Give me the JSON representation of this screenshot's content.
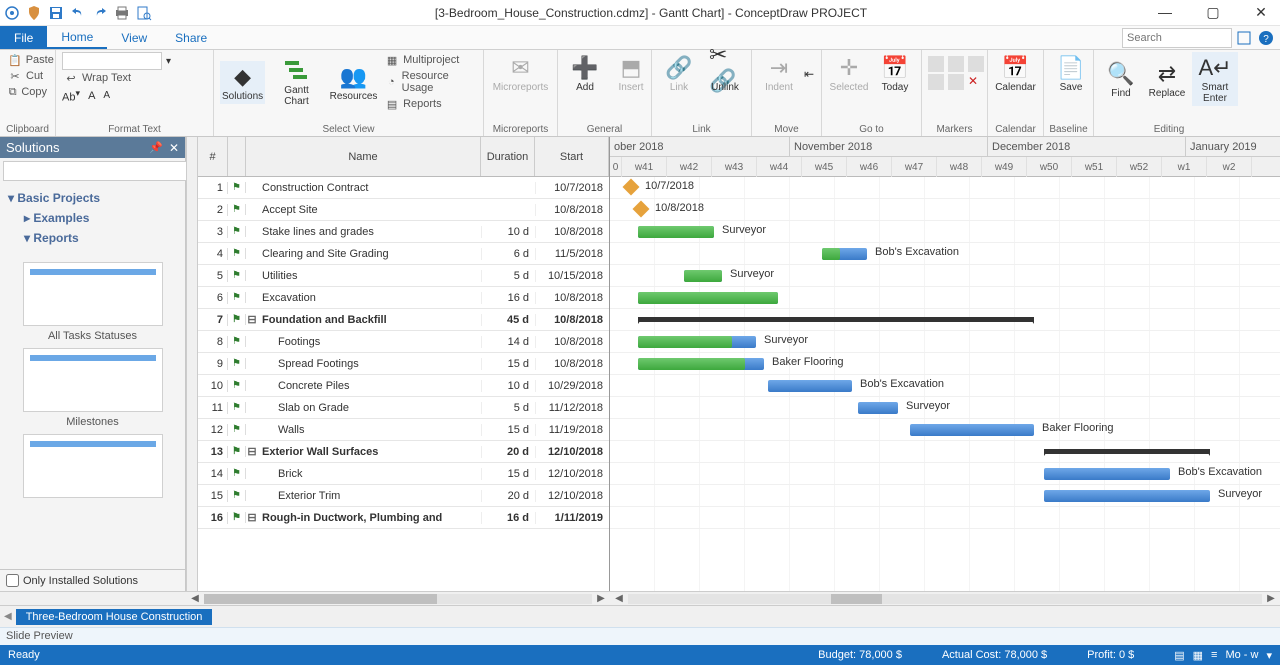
{
  "window": {
    "title": "[3-Bedroom_House_Construction.cdmz] - Gantt Chart] - ConceptDraw PROJECT",
    "controls": {
      "min": "—",
      "max": "▢",
      "close": "✕"
    }
  },
  "menubar": {
    "file": "File",
    "tabs": [
      "Home",
      "View",
      "Share"
    ],
    "active": "Home",
    "search_placeholder": "Search"
  },
  "ribbon": {
    "clipboard": {
      "paste": "Paste",
      "cut": "Cut",
      "copy": "Copy",
      "group": "Clipboard"
    },
    "formattext": {
      "wrap": "Wrap Text",
      "group": "Format Text"
    },
    "selectview": {
      "solutions": "Solutions",
      "gantt": "Gantt\nChart",
      "resources": "Resources",
      "multiproject": "Multiproject",
      "resource_usage": "Resource Usage",
      "reports": "Reports",
      "group": "Select View"
    },
    "micro": {
      "microreports": "Microreports",
      "group": "Microreports"
    },
    "general": {
      "add": "Add",
      "insert": "Insert",
      "group": "General"
    },
    "link": {
      "link": "Link",
      "unlink": "Unlink",
      "group": "Link"
    },
    "move": {
      "indent": "Indent",
      "group": "Move"
    },
    "goto": {
      "selected": "Selected",
      "today": "Today",
      "group": "Go to"
    },
    "markers": {
      "group": "Markers"
    },
    "calendar": {
      "calendar": "Calendar",
      "group": "Calendar"
    },
    "baseline": {
      "save": "Save",
      "group": "Baseline"
    },
    "editing": {
      "find": "Find",
      "replace": "Replace",
      "smart": "Smart\nEnter",
      "group": "Editing"
    }
  },
  "sidepanel": {
    "title": "Solutions",
    "tree": {
      "root": "Basic Projects",
      "children": [
        "Examples",
        "Reports"
      ]
    },
    "thumbs": [
      "All Tasks Statuses",
      "Milestones"
    ],
    "only_installed": "Only Installed Solutions"
  },
  "grid": {
    "headers": {
      "num": "#",
      "name": "Name",
      "duration": "Duration",
      "start": "Start"
    },
    "rows": [
      {
        "n": 1,
        "name": "Construction Contract",
        "dur": "",
        "start": "10/7/2018",
        "type": "ms",
        "indent": 0
      },
      {
        "n": 2,
        "name": "Accept Site",
        "dur": "",
        "start": "10/8/2018",
        "type": "ms",
        "indent": 0
      },
      {
        "n": 3,
        "name": "Stake lines and grades",
        "dur": "10 d",
        "start": "10/8/2018",
        "type": "task",
        "indent": 0,
        "res": "Surveyor",
        "complete": 1,
        "barStart": 28,
        "barW": 76
      },
      {
        "n": 4,
        "name": "Clearing and Site Grading",
        "dur": "6 d",
        "start": "11/5/2018",
        "type": "task",
        "indent": 0,
        "res": "Bob's Excavation",
        "complete": 0.4,
        "barStart": 212,
        "barW": 45
      },
      {
        "n": 5,
        "name": "Utilities",
        "dur": "5 d",
        "start": "10/15/2018",
        "type": "task",
        "indent": 0,
        "res": "Surveyor",
        "complete": 1,
        "barStart": 74,
        "barW": 38
      },
      {
        "n": 6,
        "name": "Excavation",
        "dur": "16 d",
        "start": "10/8/2018",
        "type": "task",
        "indent": 0,
        "res": "",
        "complete": 1,
        "barStart": 28,
        "barW": 140
      },
      {
        "n": 7,
        "name": "Foundation and Backfill",
        "dur": "45 d",
        "start": "10/8/2018",
        "type": "summary",
        "indent": 0,
        "barStart": 28,
        "barW": 396
      },
      {
        "n": 8,
        "name": "Footings",
        "dur": "14 d",
        "start": "10/8/2018",
        "type": "task",
        "indent": 1,
        "res": "Surveyor",
        "complete": 0.8,
        "barStart": 28,
        "barW": 118
      },
      {
        "n": 9,
        "name": "Spread Footings",
        "dur": "15 d",
        "start": "10/8/2018",
        "type": "task",
        "indent": 1,
        "res": "Baker Flooring",
        "complete": 0.85,
        "barStart": 28,
        "barW": 126
      },
      {
        "n": 10,
        "name": "Concrete Piles",
        "dur": "10 d",
        "start": "10/29/2018",
        "type": "task",
        "indent": 1,
        "res": "Bob's Excavation",
        "complete": 0,
        "barStart": 158,
        "barW": 84
      },
      {
        "n": 11,
        "name": "Slab on Grade",
        "dur": "5 d",
        "start": "11/12/2018",
        "type": "task",
        "indent": 1,
        "res": "Surveyor",
        "complete": 0,
        "barStart": 248,
        "barW": 40
      },
      {
        "n": 12,
        "name": "Walls",
        "dur": "15 d",
        "start": "11/19/2018",
        "type": "task",
        "indent": 1,
        "res": "Baker Flooring",
        "complete": 0,
        "barStart": 300,
        "barW": 124
      },
      {
        "n": 13,
        "name": "Exterior Wall Surfaces",
        "dur": "20 d",
        "start": "12/10/2018",
        "type": "summary",
        "indent": 0,
        "barStart": 434,
        "barW": 166
      },
      {
        "n": 14,
        "name": "Brick",
        "dur": "15 d",
        "start": "12/10/2018",
        "type": "task",
        "indent": 1,
        "res": "Bob's Excavation",
        "complete": 0,
        "barStart": 434,
        "barW": 126
      },
      {
        "n": 15,
        "name": "Exterior Trim",
        "dur": "20 d",
        "start": "12/10/2018",
        "type": "task",
        "indent": 1,
        "res": "Surveyor",
        "complete": 0,
        "barStart": 434,
        "barW": 166
      },
      {
        "n": 16,
        "name": "Rough-in Ductwork, Plumbing and",
        "dur": "16 d",
        "start": "1/11/2019",
        "type": "summary",
        "indent": 0,
        "barStart": 0,
        "barW": 0
      }
    ]
  },
  "timeline": {
    "months": [
      {
        "label": "ober 2018",
        "w": 180
      },
      {
        "label": "November 2018",
        "w": 198
      },
      {
        "label": "December 2018",
        "w": 198
      },
      {
        "label": "January 2019",
        "w": 106
      }
    ],
    "weeks": [
      "0",
      "w41",
      "w42",
      "w43",
      "w44",
      "w45",
      "w46",
      "w47",
      "w48",
      "w49",
      "w50",
      "w51",
      "w52",
      "w1",
      "w2"
    ],
    "weekW": 45
  },
  "doctab": "Three-Bedroom House Construction",
  "preview": "Slide Preview",
  "status": {
    "ready": "Ready",
    "budget": "Budget: 78,000 $",
    "actual": "Actual Cost: 78,000 $",
    "profit": "Profit: 0 $",
    "zoom": "Mo - w"
  },
  "milestones": [
    {
      "row": 0,
      "x": 15,
      "lbl": "10/7/2018"
    },
    {
      "row": 1,
      "x": 25,
      "lbl": "10/8/2018"
    }
  ]
}
